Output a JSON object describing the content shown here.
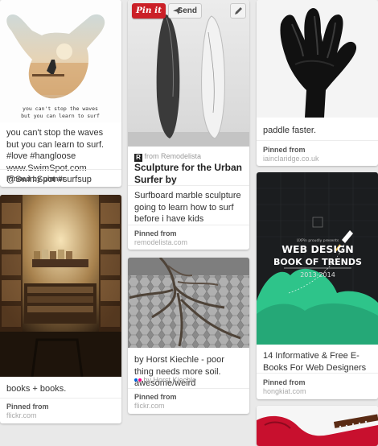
{
  "pins": [
    {
      "id": "hang-loose",
      "image_text": [
        "you can't stop the waves",
        "but you can learn to surf"
      ],
      "description": "you can't stop the waves but you can learn to surf. #love #hangloose www.SwimSpot.com @SwimSpot #surfsup",
      "footer_label": "Pinned by pinner"
    },
    {
      "id": "books",
      "description": "books + books.",
      "footer_label": "Pinned from",
      "footer_source": "flickr.com"
    },
    {
      "id": "surfboard",
      "buttons": {
        "pin_it": "Pin it",
        "send": "Send"
      },
      "via_prefix": "from",
      "via_source": "Remodelista",
      "title": "Sculpture for the Urban Surfer by",
      "description": "Surfboard marble sculpture going to learn how to surf before i have kids",
      "footer_label": "Pinned from",
      "footer_source": "remodelista.com"
    },
    {
      "id": "tree-roots",
      "description": "by Horst Kiechle - poor thing needs more soil. awesome/weird",
      "via_text": "by Horst Kiechle",
      "footer_label": "Pinned from",
      "footer_source": "flickr.com"
    },
    {
      "id": "dark-hand",
      "description": "paddle faster.",
      "footer_label": "Pinned from",
      "footer_source": "iainclaridge.co.uk"
    },
    {
      "id": "web-design",
      "image_text": {
        "small": "UXPin proudly presents",
        "line1": "WEB DESIGN",
        "line2": "BOOK OF TRENDS",
        "years": "2013-2014"
      },
      "description": "14 Informative & Free E-Books For Web Designers",
      "footer_label": "Pinned from",
      "footer_source": "hongkiat.com"
    },
    {
      "id": "red-guitar"
    }
  ],
  "colors": {
    "pin_it_red": "#cb2027",
    "web_design_teal": "#2ec48a",
    "background": "#e9e9e9"
  }
}
